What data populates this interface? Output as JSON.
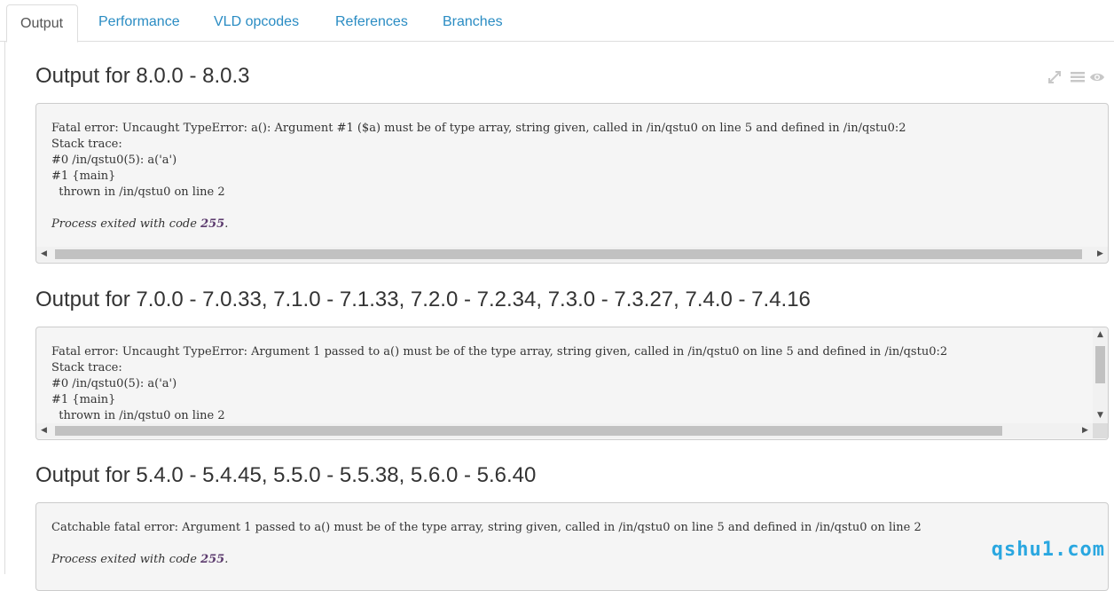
{
  "tabs": [
    {
      "label": "Output",
      "active": true
    },
    {
      "label": "Performance",
      "active": false
    },
    {
      "label": "VLD opcodes",
      "active": false
    },
    {
      "label": "References",
      "active": false
    },
    {
      "label": "Branches",
      "active": false
    }
  ],
  "toolbar": {
    "icons": [
      "expand-icon",
      "list-icon",
      "eye-icon"
    ],
    "icon_color": "#c8c8c8"
  },
  "sections": [
    {
      "title": "Output for 8.0.0 - 8.0.3",
      "lines": [
        "Fatal error: Uncaught TypeError: a(): Argument #1 ($a) must be of type array, string given, called in /in/qstu0 on line 5 and defined in /in/qstu0:2",
        "Stack trace:",
        "#0 /in/qstu0(5): a('a')",
        "#1 {main}",
        "  thrown in /in/qstu0 on line 2"
      ],
      "exit_prefix": "Process exited with code ",
      "exit_code": "255",
      "exit_suffix": "."
    },
    {
      "title": "Output for 7.0.0 - 7.0.33, 7.1.0 - 7.1.33, 7.2.0 - 7.2.34, 7.3.0 - 7.3.27, 7.4.0 - 7.4.16",
      "lines": [
        "Fatal error: Uncaught TypeError: Argument 1 passed to a() must be of the type array, string given, called in /in/qstu0 on line 5 and defined in /in/qstu0:2",
        "Stack trace:",
        "#0 /in/qstu0(5): a('a')",
        "#1 {main}",
        "  thrown in /in/qstu0 on line 2"
      ]
    },
    {
      "title": "Output for 5.4.0 - 5.4.45, 5.5.0 - 5.5.38, 5.6.0 - 5.6.40",
      "lines": [
        "Catchable fatal error: Argument 1 passed to a() must be of the type array, string given, called in /in/qstu0 on line 5 and defined in /in/qstu0 on line 2"
      ],
      "exit_prefix": "Process exited with code ",
      "exit_code": "255",
      "exit_suffix": "."
    }
  ],
  "watermark": "qshu1.com",
  "colors": {
    "tab_link": "#2a8cc3",
    "exit_code": "#5c3b6e",
    "watermark": "#2aa7e0"
  }
}
